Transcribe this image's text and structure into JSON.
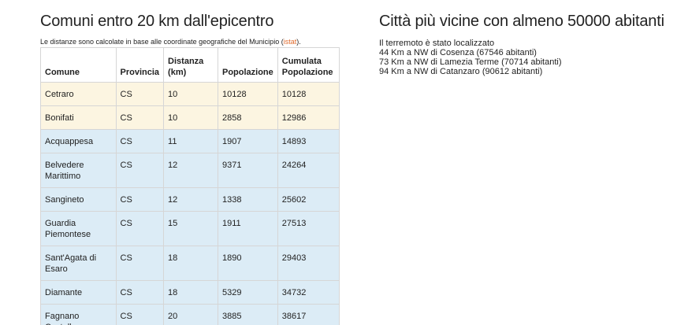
{
  "left": {
    "title": "Comuni entro 20 km dall'epicentro",
    "note_text": "Le distanze sono calcolate in base alle coordinate geografiche del Municipio (",
    "note_link": "istat",
    "note_tail": ").",
    "columns": [
      "Comune",
      "Provincia",
      "Distanza (km)",
      "Popolazione",
      "Cumulata Popolazione"
    ],
    "rows": [
      {
        "comune": "Cetraro",
        "provincia": "CS",
        "distanza": "10",
        "popolazione": "10128",
        "cumulata": "10128",
        "highlight": "beige"
      },
      {
        "comune": "Bonifati",
        "provincia": "CS",
        "distanza": "10",
        "popolazione": "2858",
        "cumulata": "12986",
        "highlight": "beige"
      },
      {
        "comune": "Acquappesa",
        "provincia": "CS",
        "distanza": "11",
        "popolazione": "1907",
        "cumulata": "14893",
        "highlight": "blue"
      },
      {
        "comune": "Belvedere Marittimo",
        "provincia": "CS",
        "distanza": "12",
        "popolazione": "9371",
        "cumulata": "24264",
        "highlight": "blue"
      },
      {
        "comune": "Sangineto",
        "provincia": "CS",
        "distanza": "12",
        "popolazione": "1338",
        "cumulata": "25602",
        "highlight": "blue"
      },
      {
        "comune": "Guardia Piemontese",
        "provincia": "CS",
        "distanza": "15",
        "popolazione": "1911",
        "cumulata": "27513",
        "highlight": "blue"
      },
      {
        "comune": "Sant'Agata di Esaro",
        "provincia": "CS",
        "distanza": "18",
        "popolazione": "1890",
        "cumulata": "29403",
        "highlight": "blue"
      },
      {
        "comune": "Diamante",
        "provincia": "CS",
        "distanza": "18",
        "popolazione": "5329",
        "cumulata": "34732",
        "highlight": "blue"
      },
      {
        "comune": "Fagnano Castello",
        "provincia": "CS",
        "distanza": "20",
        "popolazione": "3885",
        "cumulata": "38617",
        "highlight": "blue"
      }
    ]
  },
  "right": {
    "title": "Città più vicine con almeno 50000 abitanti",
    "lines": [
      "Il terremoto è stato localizzato",
      "44 Km a NW di Cosenza (67546 abitanti)",
      "73 Km a NW di Lamezia Terme (70714 abitanti)",
      "94 Km a NW di Catanzaro (90612 abitanti)"
    ]
  }
}
